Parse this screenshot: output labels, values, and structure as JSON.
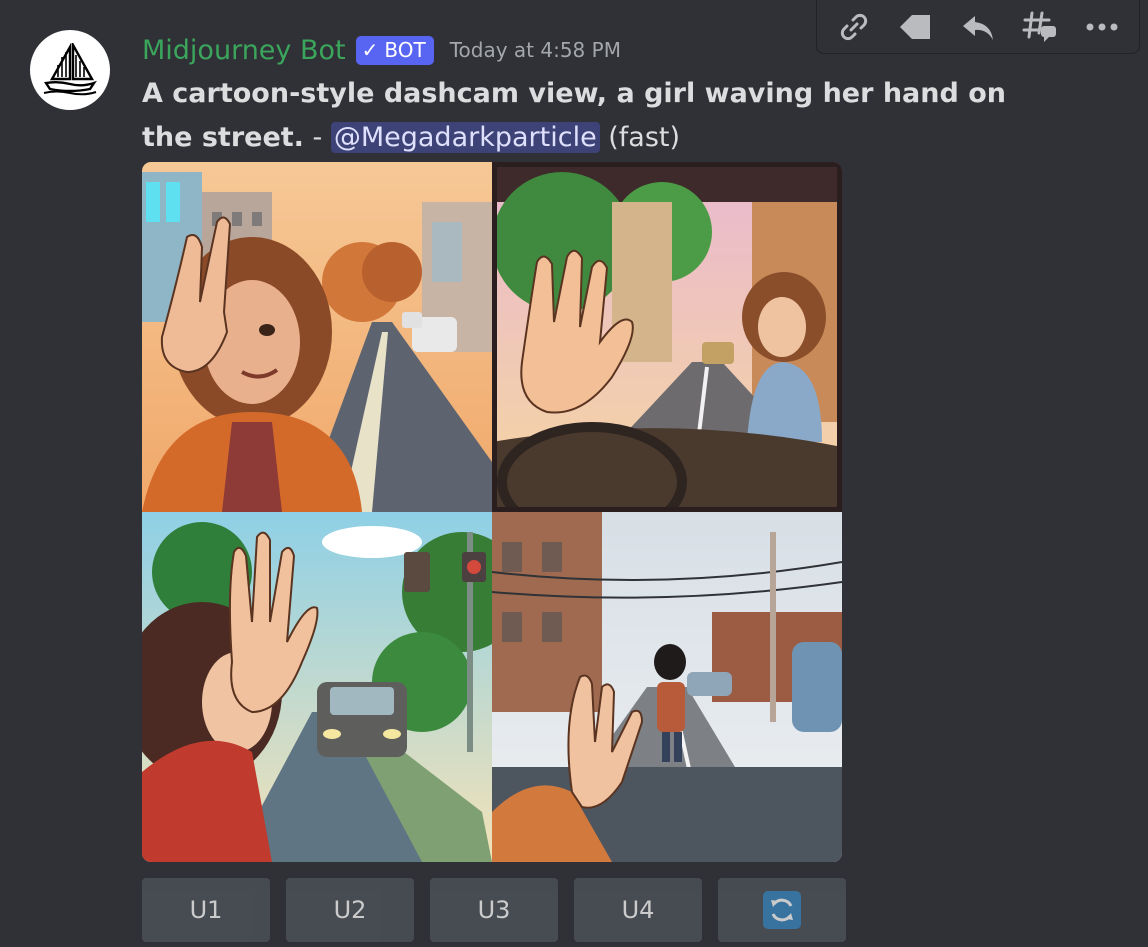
{
  "author": {
    "name": "Midjourney Bot",
    "bot_tag": "BOT",
    "verified_mark": "✓",
    "timestamp": "Today at 4:58 PM",
    "name_color": "#3ba55c"
  },
  "message": {
    "prompt": "A cartoon-style dashcam view, a girl waving her hand on the street.",
    "separator": " - ",
    "mention": "@Megadarkparticle",
    "mode": " (fast)"
  },
  "toolbar": {
    "icons": [
      "link-icon",
      "tag-icon",
      "reply-icon",
      "thread-icon",
      "more-icon"
    ]
  },
  "image_grid": {
    "tiles": [
      "image-1",
      "image-2",
      "image-3",
      "image-4"
    ]
  },
  "buttons": [
    {
      "label": "U1"
    },
    {
      "label": "U2"
    },
    {
      "label": "U3"
    },
    {
      "label": "U4"
    }
  ],
  "reroll": {
    "icon": "reroll-icon",
    "color": "#3b88c3"
  },
  "colors": {
    "background": "#2f3136",
    "bot_tag": "#5865f2",
    "mention_bg": "rgba(88,101,242,0.35)"
  }
}
